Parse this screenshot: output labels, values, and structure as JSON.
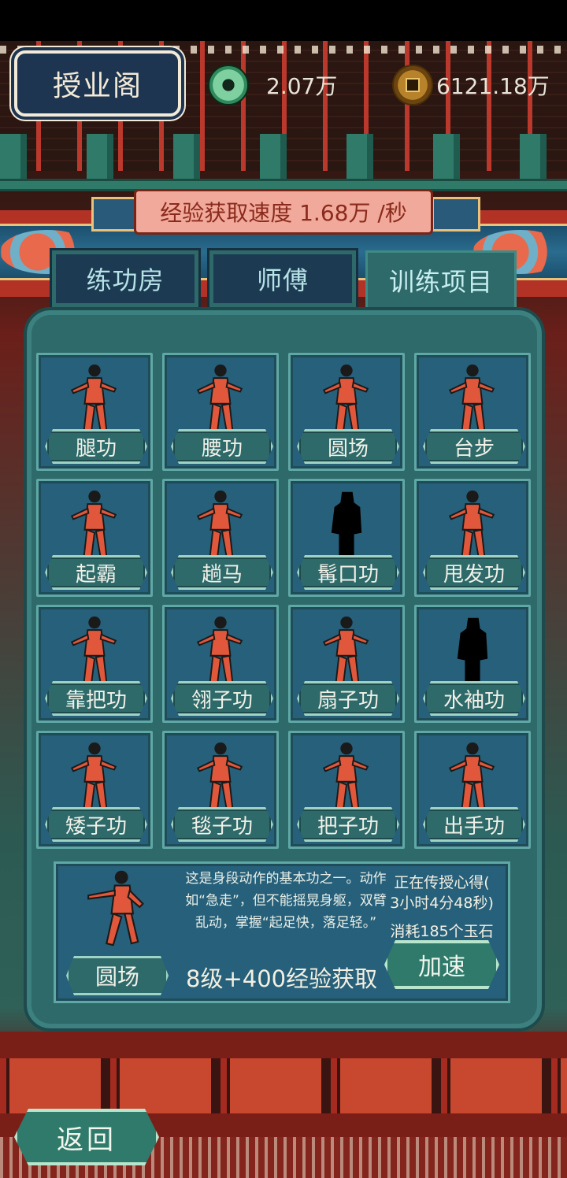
{
  "header": {
    "title": "授业阁",
    "jade_currency": "2.07万",
    "coin_currency": "6121.18万",
    "exp_speed": "经验获取速度 1.68万 /秒"
  },
  "tabs": [
    {
      "label": "练功房",
      "active": false
    },
    {
      "label": "师傅",
      "active": false
    },
    {
      "label": "训练项目",
      "active": true
    }
  ],
  "skills": [
    {
      "label": "腿功",
      "icon": "leg-kick-figure-icon"
    },
    {
      "label": "腰功",
      "icon": "backbend-figure-icon"
    },
    {
      "label": "圆场",
      "icon": "walking-figure-icon"
    },
    {
      "label": "台步",
      "icon": "stage-step-figure-icon"
    },
    {
      "label": "起霸",
      "icon": "general-pose-figure-icon"
    },
    {
      "label": "趟马",
      "icon": "horsewhip-figure-icon"
    },
    {
      "label": "髯口功",
      "icon": "locked-silhouette-icon"
    },
    {
      "label": "甩发功",
      "icon": "hair-swing-figure-icon"
    },
    {
      "label": "靠把功",
      "icon": "armor-flags-figure-icon"
    },
    {
      "label": "翎子功",
      "icon": "pheasant-feather-figure-icon"
    },
    {
      "label": "扇子功",
      "icon": "fan-figure-icon"
    },
    {
      "label": "水袖功",
      "icon": "locked-silhouette-icon"
    },
    {
      "label": "矮子功",
      "icon": "squat-figure-icon"
    },
    {
      "label": "毯子功",
      "icon": "tumbling-figure-icon"
    },
    {
      "label": "把子功",
      "icon": "weapon-stance-figure-icon"
    },
    {
      "label": "出手功",
      "icon": "throwing-figure-icon"
    }
  ],
  "detail": {
    "name": "圆场",
    "description": "这是身段动作的基本功之一。动作如“急走”，但不能摇晃身躯，双臂乱动，掌握“起足快，落足轻。”",
    "status_line1": "正在传授心得(",
    "status_line2": "3小时4分48秒)",
    "cost": "消耗185个玉石",
    "exp_gain": "8级+400经验获取",
    "speedup_label": "加速"
  },
  "back_label": "返回",
  "colors": {
    "panel": "#2e6a6a",
    "card": "#27607a",
    "figure": "#e0573b",
    "banner": "#f0a99a",
    "title_plaque": "#1d3550"
  }
}
